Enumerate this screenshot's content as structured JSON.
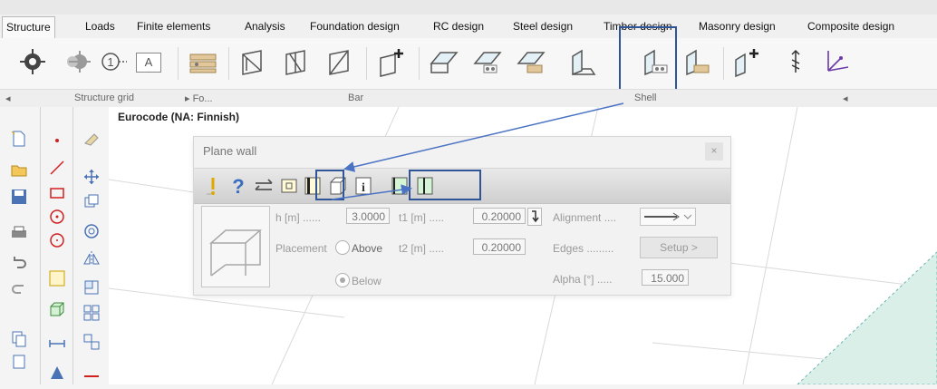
{
  "menu": {
    "tabs": [
      "Structure",
      "Loads",
      "Finite elements",
      "Analysis",
      "Foundation design",
      "RC design",
      "Steel design",
      "Timber design",
      "Masonry design",
      "Composite design"
    ]
  },
  "ribbon": {
    "groups": {
      "structure_grid": "Structure grid",
      "foundation": "Fo...",
      "bar": "Bar",
      "shell": "Shell"
    },
    "text_icon": "A",
    "circled_one": "①"
  },
  "canvas": {
    "standard": "Eurocode (NA: Finnish)"
  },
  "dialog": {
    "title": "Plane wall",
    "close": "×",
    "h_label": "h [m] ......",
    "h_value": "3.0000",
    "t1_label": "t1 [m] .....",
    "t1_value": "0.20000",
    "alignment_label": "Alignment ....",
    "placement_label": "Placement",
    "above_label": "Above",
    "below_label": "Below",
    "t2_label": "t2 [m] .....",
    "t2_value": "0.20000",
    "edges_label": "Edges .........",
    "setup_label": "Setup >",
    "alpha_label": "Alpha [°] .....",
    "alpha_value": "15.000",
    "placement_selected": "Below"
  },
  "colors": {
    "highlight": "#2f5597",
    "canvas": "#ffffff",
    "shell_fill": "#d9efe8"
  }
}
